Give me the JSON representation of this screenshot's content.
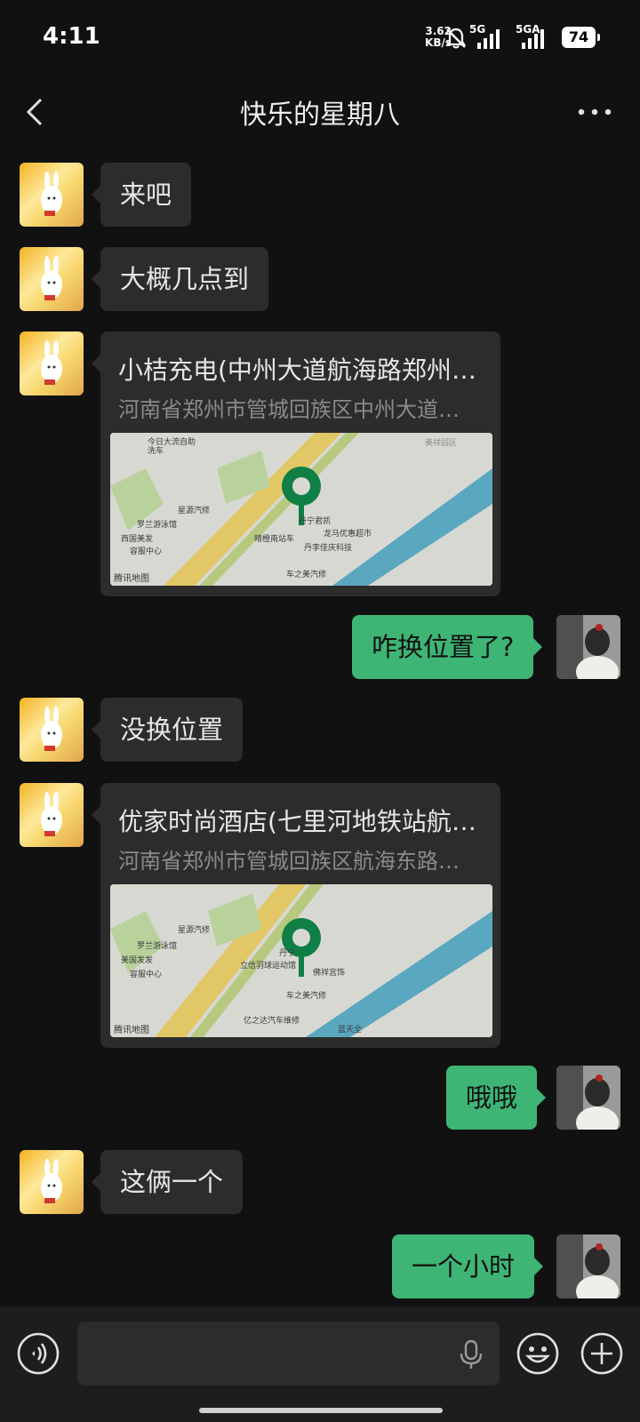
{
  "status_bar": {
    "time": "4:11",
    "net_speed_value": "3.62",
    "net_speed_unit": "KB/s",
    "signal1_label": "5G",
    "signal2_label": "5GA",
    "battery": "74",
    "icons": [
      "mute-bell-icon",
      "signal-icon",
      "signal-icon",
      "battery-icon"
    ]
  },
  "header": {
    "title": "快乐的星期八",
    "back_icon": "chevron-left-icon",
    "more_icon": "more-dots-icon"
  },
  "messages": [
    {
      "side": "in",
      "type": "text",
      "text": "来吧"
    },
    {
      "side": "in",
      "type": "text",
      "text": "大概几点到"
    },
    {
      "side": "in",
      "type": "location",
      "title": "小桔充电(中州大道航海路郑州东…",
      "address": "河南省郑州市管城回族区中州大道…",
      "map_label": "腾讯地图",
      "map_pois": [
        "今日大流自助洗车",
        "星源汽修",
        "罗兰游泳馆",
        "西国美发",
        "容服中心",
        "晴橙南站车",
        "丹李佳庆科技",
        "龙马优惠超市",
        "车之美汽修",
        "丹宁君凯",
        "美祥园区"
      ]
    },
    {
      "side": "out",
      "type": "text",
      "text": "咋换位置了?"
    },
    {
      "side": "in",
      "type": "text",
      "text": "没换位置"
    },
    {
      "side": "in",
      "type": "location",
      "title": "优家时尚酒店(七里河地铁站航海东…",
      "address": "河南省郑州市管城回族区航海东路…",
      "map_label": "腾讯地图",
      "map_pois": [
        "星源汽修",
        "罗兰游泳馆",
        "美国发发",
        "容服中心",
        "立信羽球运动馆",
        "丹宁",
        "佛祥宫饰",
        "车之美汽修",
        "亿之达汽车维修",
        "蓝天全"
      ]
    },
    {
      "side": "out",
      "type": "text",
      "text": "哦哦"
    },
    {
      "side": "in",
      "type": "text",
      "text": "这俩一个"
    },
    {
      "side": "out",
      "type": "text",
      "text": "一个小时"
    }
  ],
  "input_bar": {
    "voice_icon": "voice-toggle-icon",
    "mic_icon": "microphone-icon",
    "emoji_icon": "emoji-icon",
    "plus_icon": "plus-icon"
  },
  "colors": {
    "background": "#111111",
    "incoming_bubble": "#2c2c2c",
    "outgoing_bubble": "#3eb575",
    "map_pin": "#0f7f46"
  }
}
